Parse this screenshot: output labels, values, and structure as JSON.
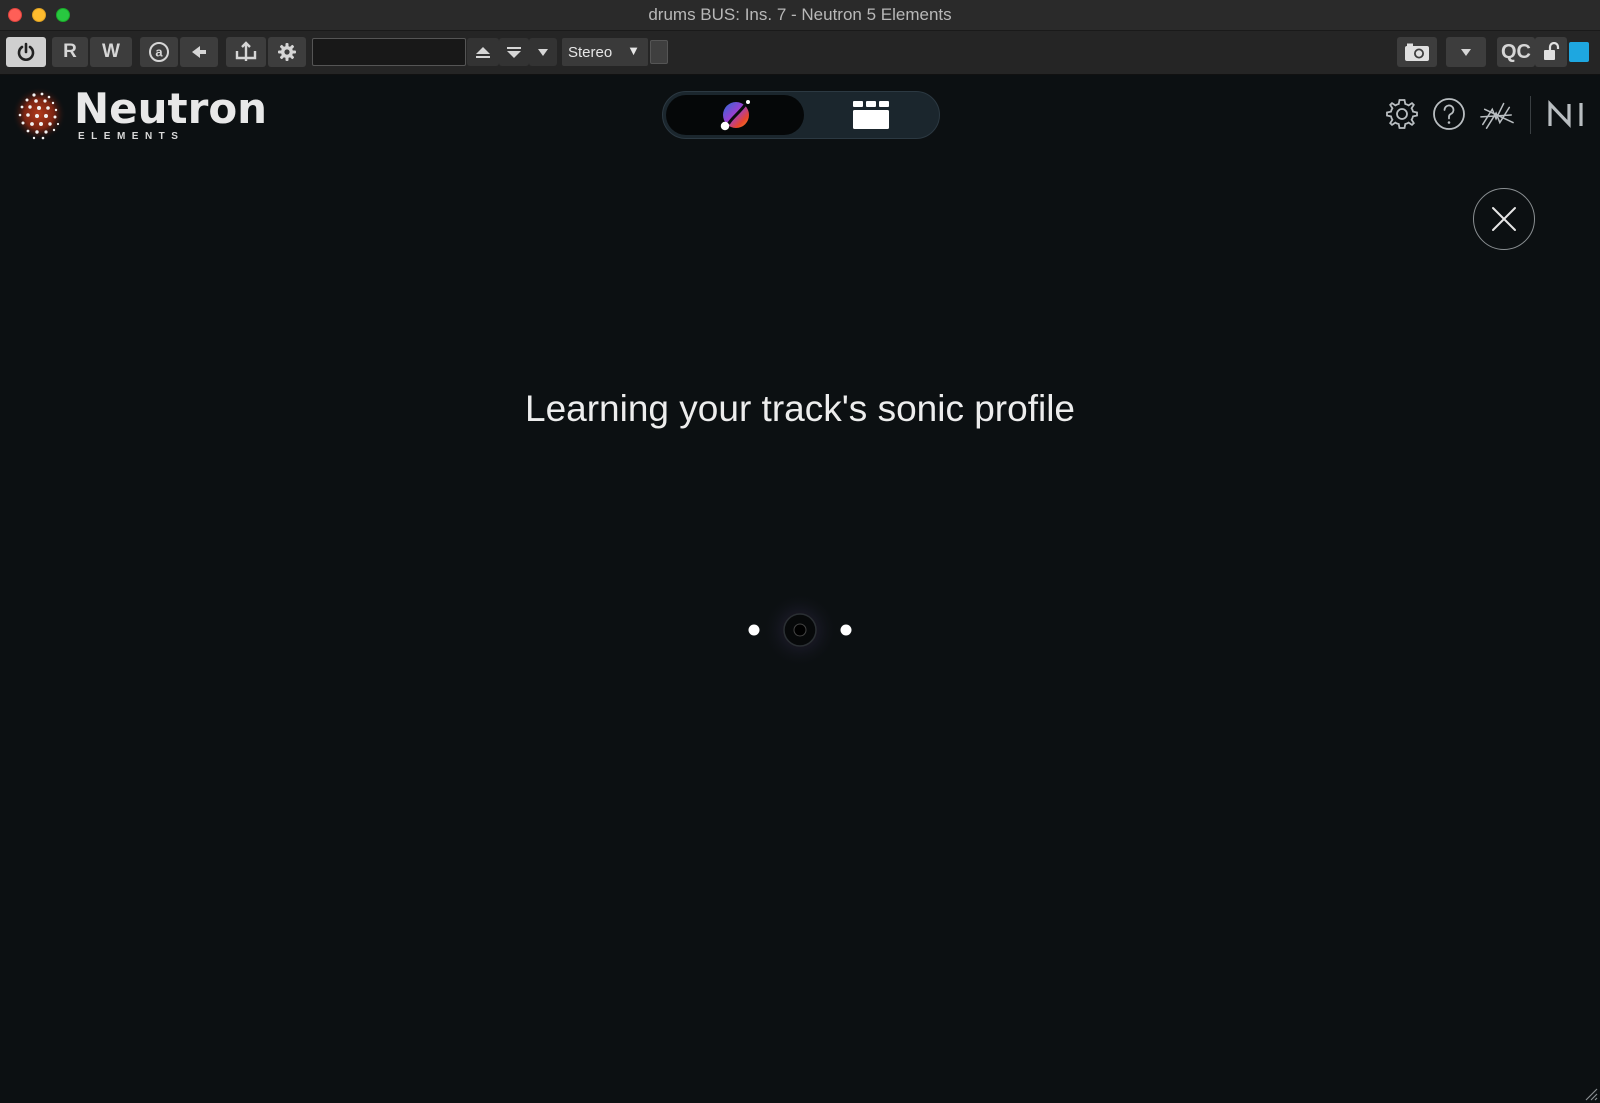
{
  "window": {
    "title": "drums BUS: Ins. 7 - Neutron 5 Elements"
  },
  "host_toolbar": {
    "read_label": "R",
    "write_label": "W",
    "preset_value": "",
    "channel_mode": "Stereo",
    "qc_label": "QC",
    "accent_color": "#1ea7e0"
  },
  "plugin": {
    "brand_name": "Neutron",
    "brand_sub": "ELEMENTS",
    "mode_assistant_icon": "assistant-orb-icon",
    "mode_modules_icon": "modules-grid-icon"
  },
  "header_icons": [
    "gear-icon",
    "help-icon",
    "ozone-link-icon",
    "ni-logo-icon"
  ],
  "main": {
    "heading": "Learning your track's sonic profile",
    "close_icon": "close-icon"
  }
}
